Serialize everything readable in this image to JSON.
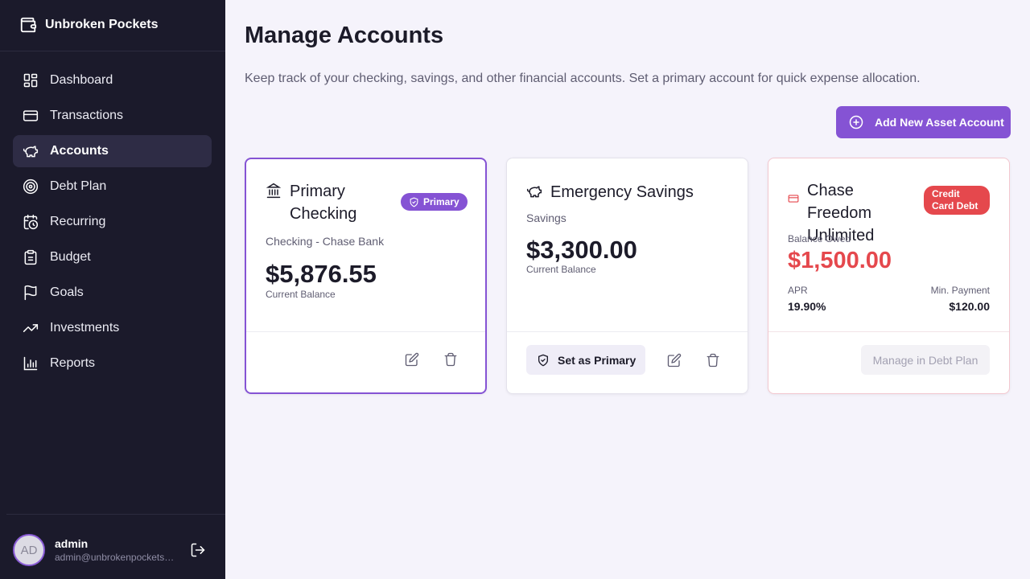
{
  "app": {
    "name": "Unbroken Pockets"
  },
  "sidebar": {
    "items": [
      {
        "label": "Dashboard",
        "icon": "dashboard-icon"
      },
      {
        "label": "Transactions",
        "icon": "credit-card-icon"
      },
      {
        "label": "Accounts",
        "icon": "piggy-bank-icon",
        "active": true
      },
      {
        "label": "Debt Plan",
        "icon": "target-icon"
      },
      {
        "label": "Recurring",
        "icon": "calendar-clock-icon"
      },
      {
        "label": "Budget",
        "icon": "clipboard-icon"
      },
      {
        "label": "Goals",
        "icon": "flag-icon"
      },
      {
        "label": "Investments",
        "icon": "trending-up-icon"
      },
      {
        "label": "Reports",
        "icon": "bar-chart-icon"
      }
    ],
    "user": {
      "initials": "AD",
      "name": "admin",
      "email": "admin@unbrokenpockets.com"
    }
  },
  "page": {
    "title": "Manage Accounts",
    "description": "Keep track of your checking, savings, and other financial accounts. Set a primary account for quick expense allocation.",
    "add_button": "Add New Asset Account"
  },
  "accounts": [
    {
      "name": "Primary Checking",
      "badge": "Primary",
      "subtitle": "Checking - Chase Bank",
      "balance": "$5,876.55",
      "balance_label": "Current Balance"
    },
    {
      "name": "Emergency Savings",
      "subtitle": "Savings",
      "balance": "$3,300.00",
      "balance_label": "Current Balance",
      "set_primary_label": "Set as Primary"
    },
    {
      "name": "Chase Freedom Unlimited",
      "badge": "Credit Card Debt",
      "balance_label": "Balance Owed",
      "balance": "$1,500.00",
      "apr_label": "APR",
      "apr": "19.90%",
      "min_payment_label": "Min. Payment",
      "min_payment": "$120.00",
      "manage_label": "Manage in Debt Plan"
    }
  ],
  "colors": {
    "accent": "#8553d4",
    "sidebar": "#1b1a2b",
    "danger": "#e5484d"
  }
}
